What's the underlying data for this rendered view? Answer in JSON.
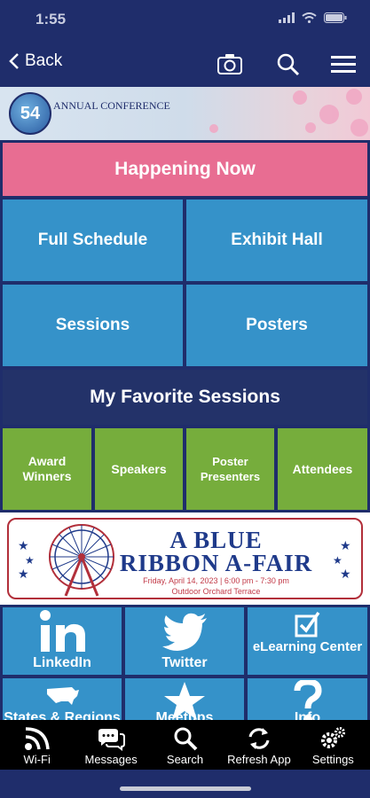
{
  "status": {
    "time": "1:55"
  },
  "nav": {
    "back_label": "Back"
  },
  "banner": {
    "number": "54",
    "conference": "ANNUAL CONFERENCE"
  },
  "tiles": {
    "happening_now": "Happening Now",
    "full_schedule": "Full Schedule",
    "exhibit_hall": "Exhibit Hall",
    "sessions": "Sessions",
    "posters": "Posters",
    "my_favorite_sessions": "My Favorite Sessions",
    "award_winners": "Award Winners",
    "speakers": "Speakers",
    "poster_presenters": "Poster Presenters",
    "attendees": "Attendees"
  },
  "fair": {
    "line1": "A BLUE",
    "line2": "RIBBON A-FAIR",
    "date": "Friday, April 14, 2023 | 6:00 pm - 7:30 pm",
    "location": "Outdoor Orchard Terrace"
  },
  "social": {
    "linkedin": "LinkedIn",
    "twitter": "Twitter",
    "elearning": "eLearning Center",
    "states": "States & Regions",
    "meetups": "Meetups",
    "info": "Info"
  },
  "tabbar": {
    "wifi": "Wi-Fi",
    "messages": "Messages",
    "search": "Search",
    "refresh": "Refresh App",
    "settings": "Settings"
  },
  "colors": {
    "navy": "#1f2d6b",
    "pink": "#e86d92",
    "blue": "#3592c9",
    "green": "#76ad3c",
    "fair_red": "#b22f3a"
  }
}
